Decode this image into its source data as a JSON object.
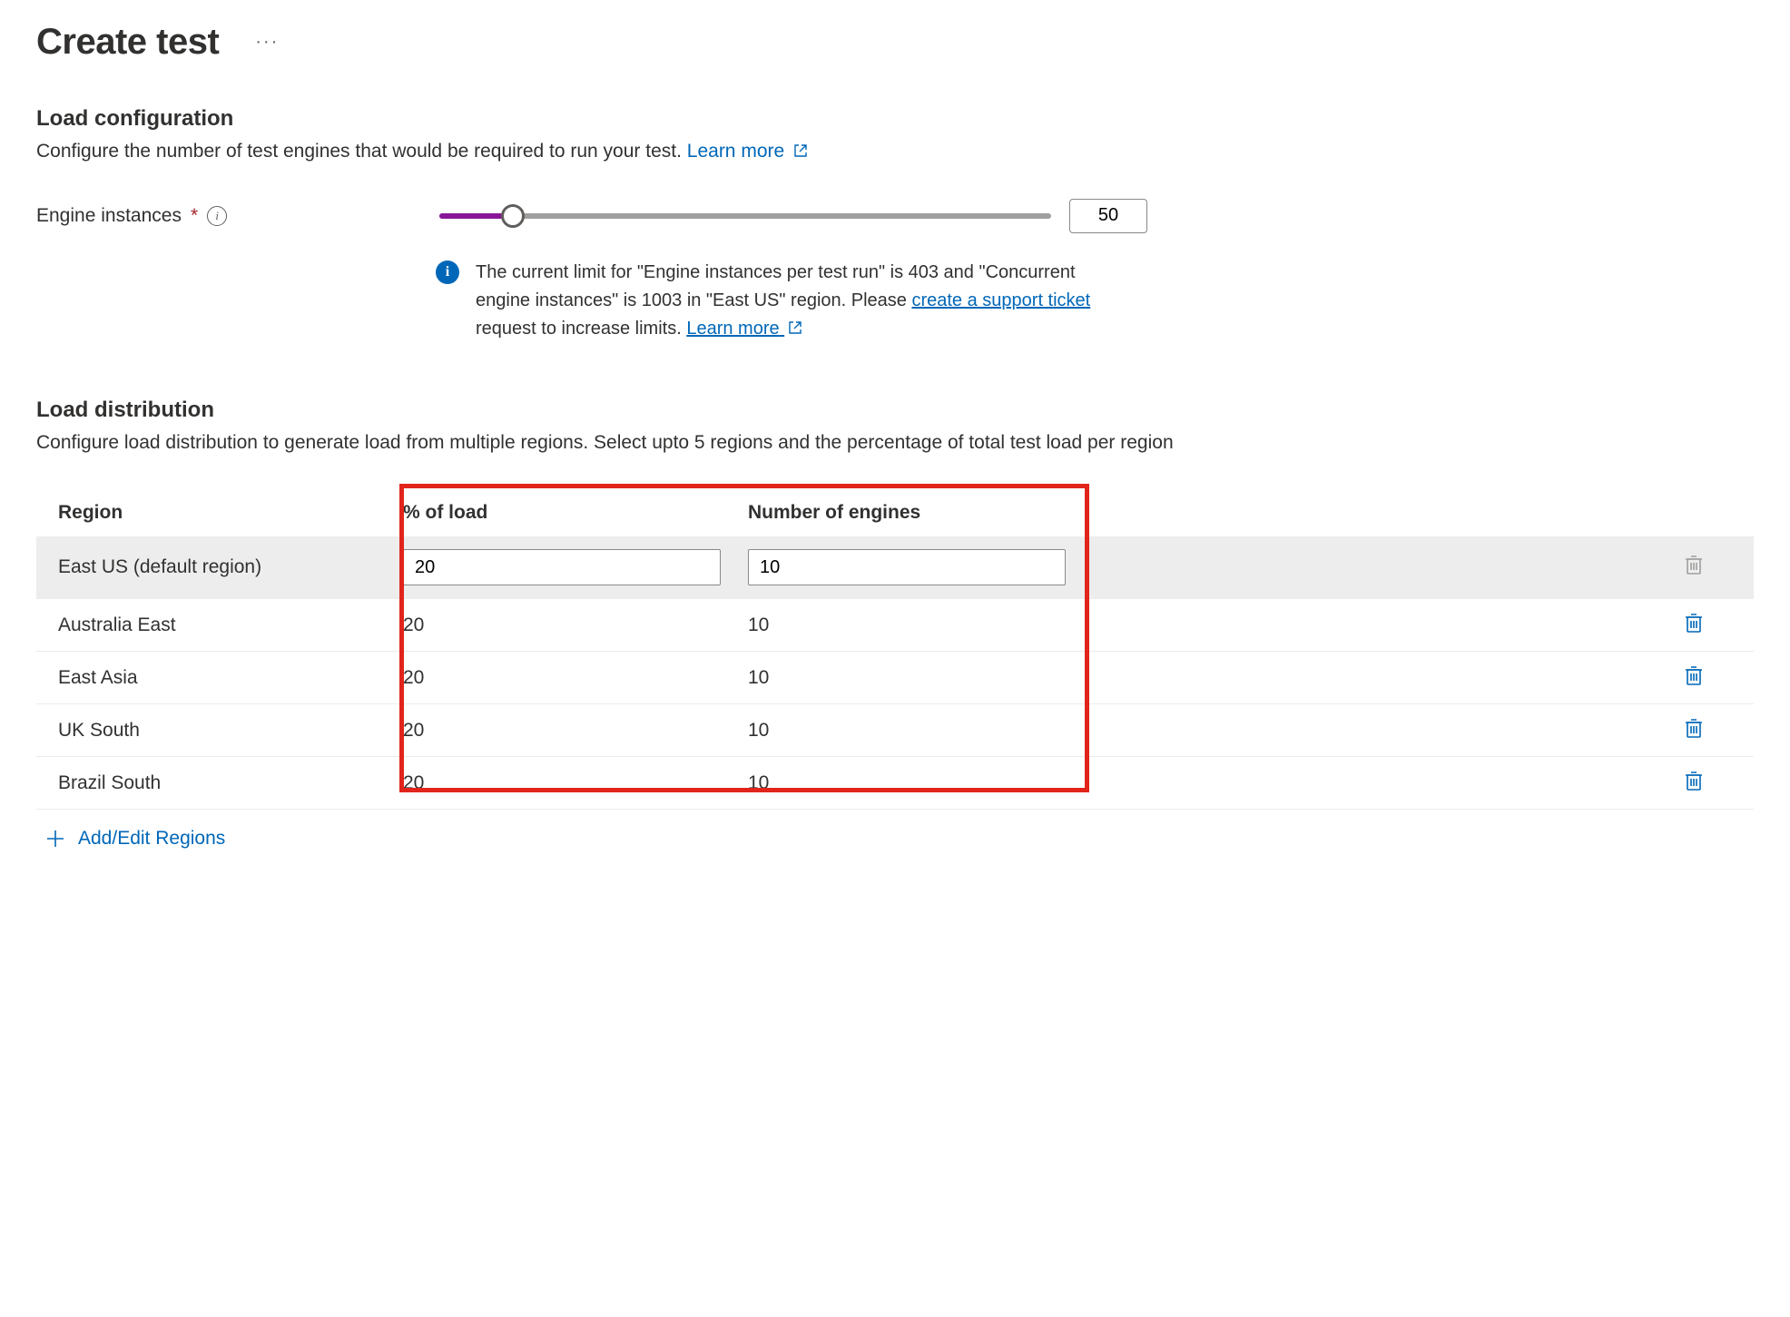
{
  "page": {
    "title": "Create test"
  },
  "loadConfig": {
    "section_title": "Load configuration",
    "description": "Configure the number of test engines that would be required to run your test.",
    "learn_more": "Learn more",
    "field_label": "Engine instances",
    "value": "50",
    "info_text_1": "The current limit for \"Engine instances per test run\" is 403 and \"Concurrent engine instances\" is 1003 in \"East US\" region. Please ",
    "info_link_1": "create a support ticket",
    "info_text_2": " request to increase limits. ",
    "info_link_2": "Learn more"
  },
  "loadDist": {
    "section_title": "Load distribution",
    "description": "Configure load distribution to generate load from multiple regions. Select upto 5 regions and the percentage of total test load per region",
    "col_region": "Region",
    "col_percent": "% of load",
    "col_engines": "Number of engines",
    "rows": [
      {
        "region": "East US (default region)",
        "percent": "20",
        "engines": "10",
        "editable": true,
        "delete_disabled": true
      },
      {
        "region": "Australia East",
        "percent": "20",
        "engines": "10",
        "editable": false,
        "delete_disabled": false
      },
      {
        "region": "East Asia",
        "percent": "20",
        "engines": "10",
        "editable": false,
        "delete_disabled": false
      },
      {
        "region": "UK South",
        "percent": "20",
        "engines": "10",
        "editable": false,
        "delete_disabled": false
      },
      {
        "region": "Brazil South",
        "percent": "20",
        "engines": "10",
        "editable": false,
        "delete_disabled": false
      }
    ],
    "add_label": "Add/Edit Regions"
  }
}
